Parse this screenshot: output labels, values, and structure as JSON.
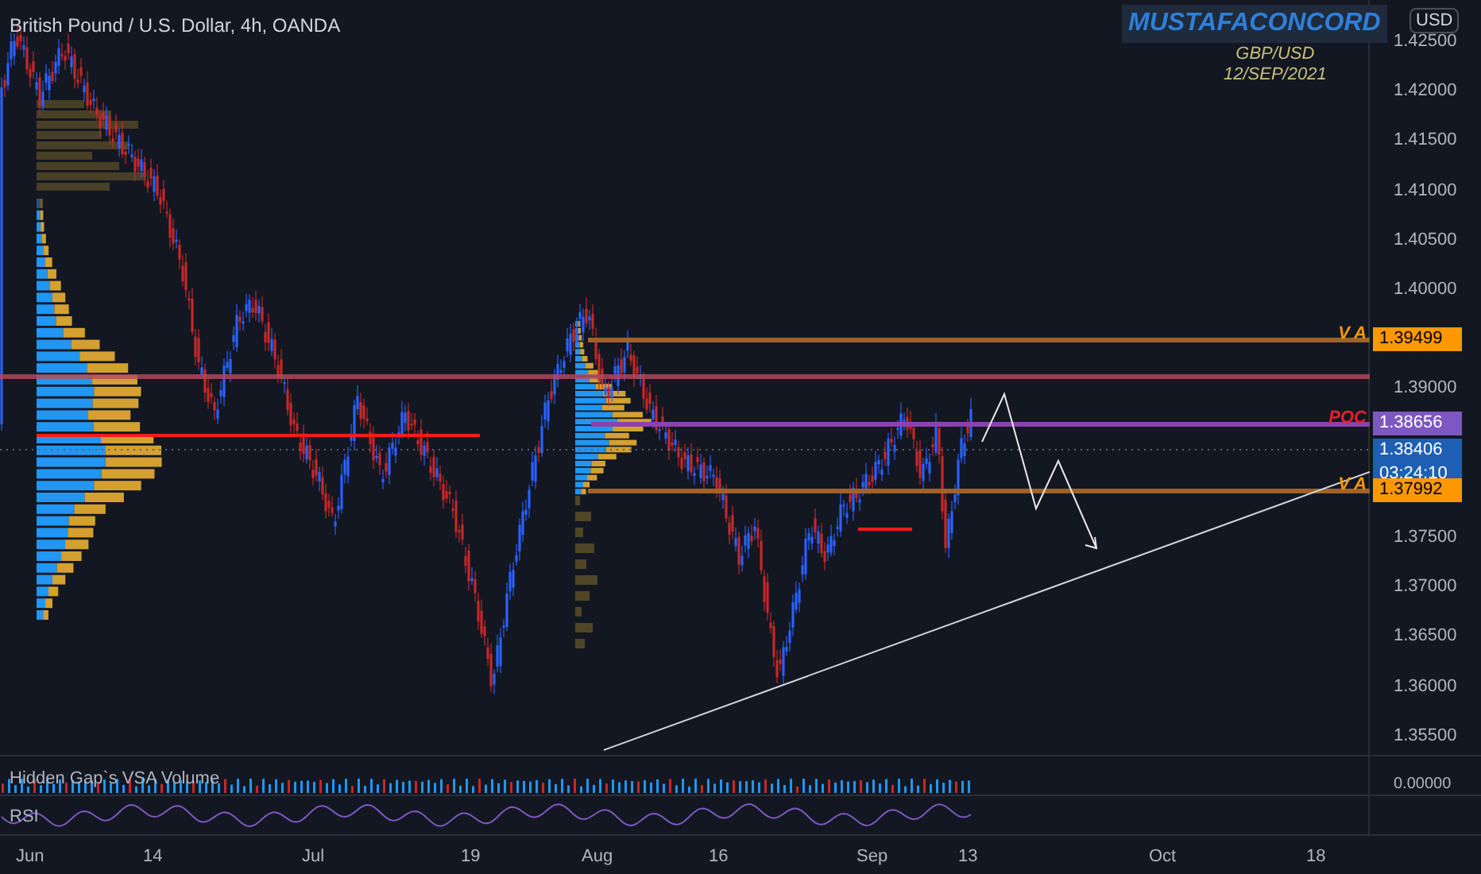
{
  "header": {
    "title": "British Pound / U.S. Dollar, 4h, OANDA"
  },
  "author": {
    "name": "MUSTAFACONCORD",
    "lines": [
      "GBP/USD",
      "12/SEP/2021"
    ]
  },
  "currency_button": "USD",
  "price_axis": [
    "1.42500",
    "1.42000",
    "1.41500",
    "1.41000",
    "1.40500",
    "1.40000",
    "1.39000",
    "1.37500",
    "1.37000",
    "1.36500",
    "1.36000",
    "1.35500"
  ],
  "levels": [
    {
      "kind": "va",
      "label": "V A",
      "price": "1.39499",
      "color": "#ff9800"
    },
    {
      "kind": "poc",
      "label": "POC",
      "price": "1.38656",
      "color": "#7e57c2"
    },
    {
      "kind": "last",
      "price": "1.38406",
      "countdown": "03:24:10",
      "color": "#1e5fb4"
    },
    {
      "kind": "va",
      "label": "V A",
      "price": "1.37992",
      "color": "#ff9800"
    }
  ],
  "indicators": [
    {
      "kind": "volume",
      "name": "Hidden Gap`s VSA Volume",
      "reading": "0.00000"
    },
    {
      "kind": "rsi",
      "name": "RSI"
    }
  ],
  "time_axis": [
    "Jun",
    "14",
    "Jul",
    "19",
    "Aug",
    "16",
    "Sep",
    "13",
    "Oct",
    "18"
  ]
}
